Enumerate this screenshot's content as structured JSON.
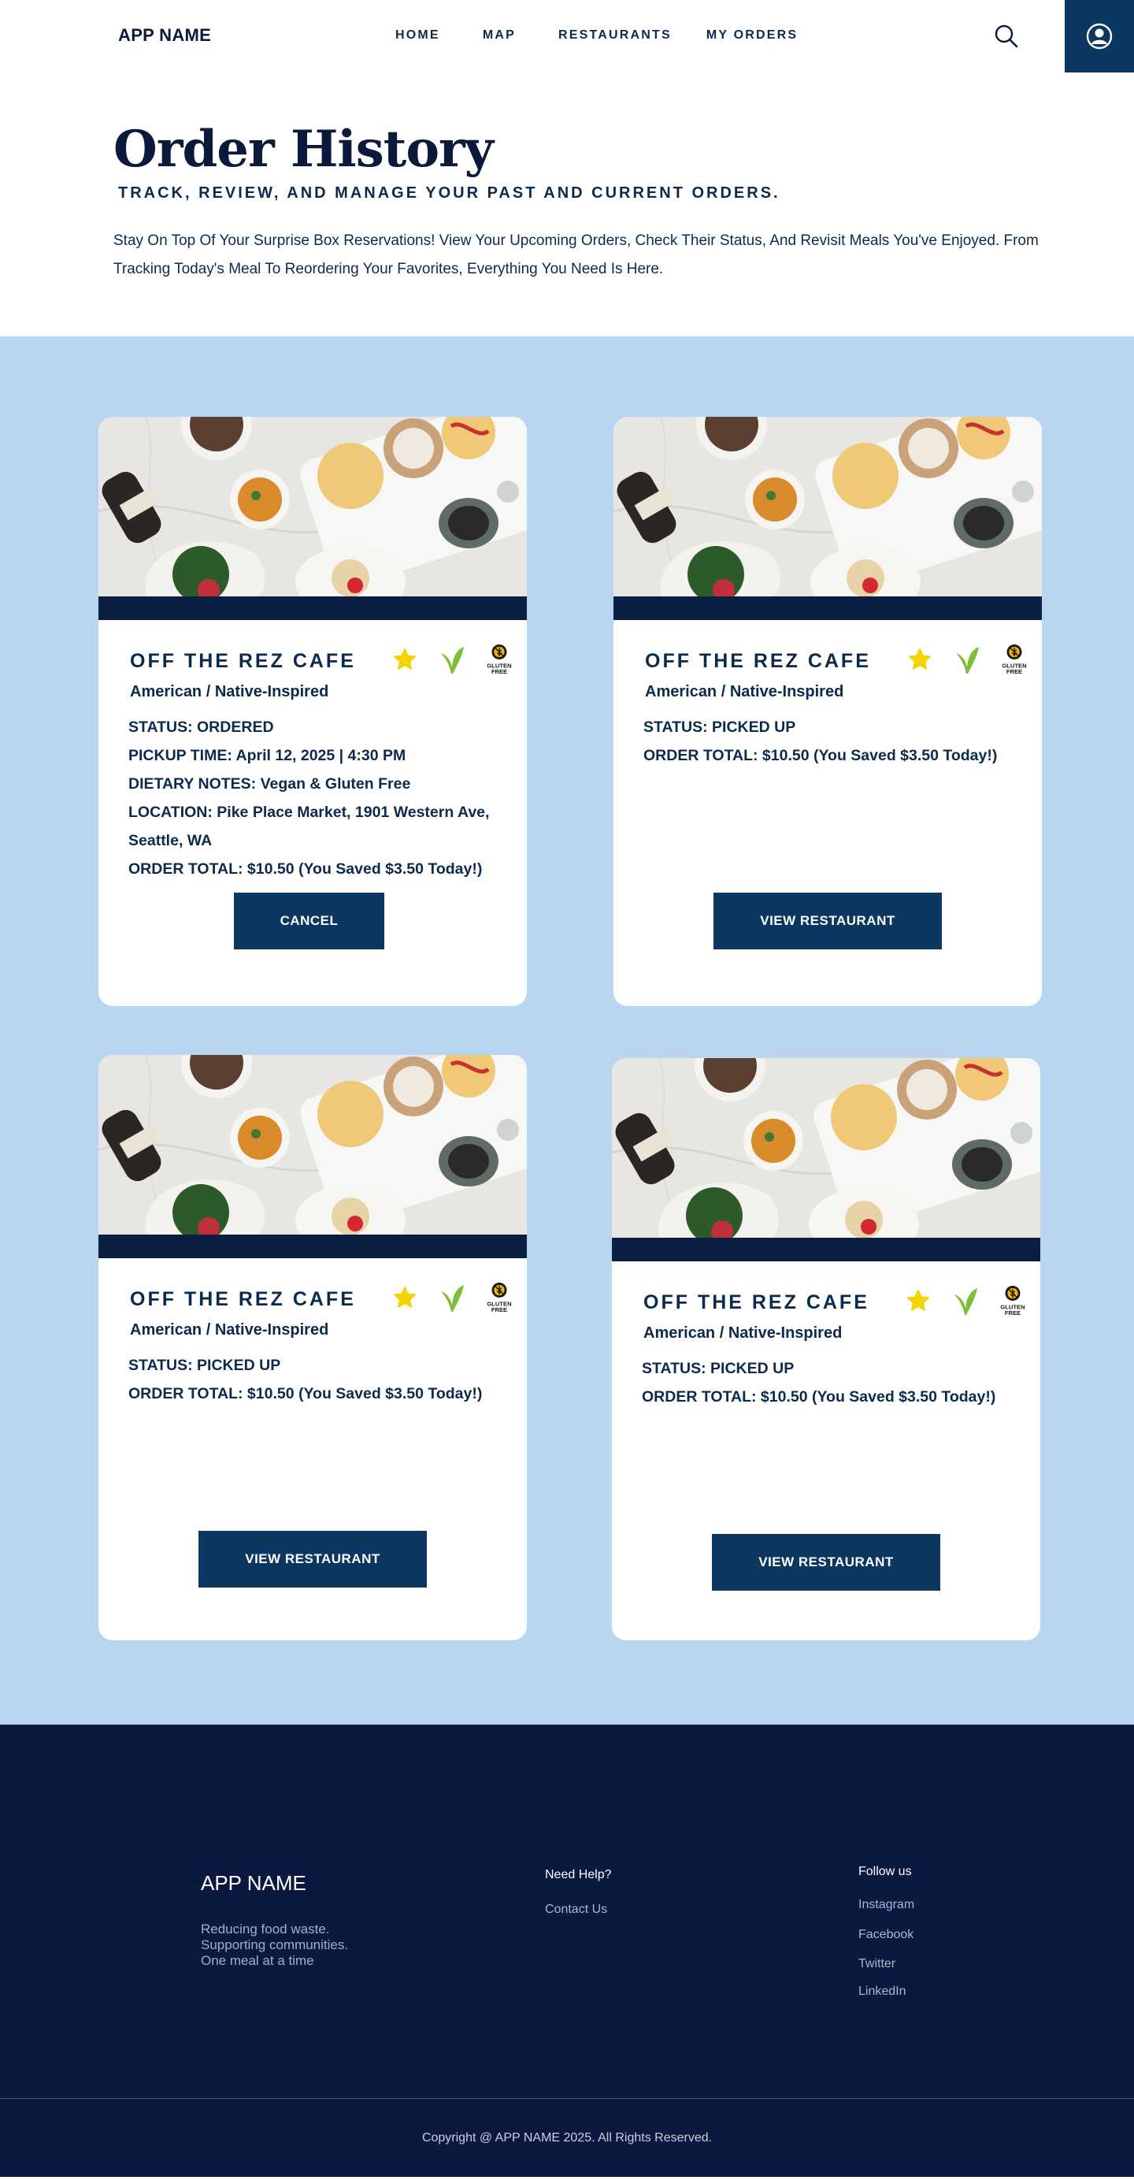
{
  "header": {
    "brand": "APP NAME",
    "nav": [
      "HOME",
      "MAP",
      "RESTAURANTS",
      "MY ORDERS"
    ],
    "icons": [
      "search-icon",
      "user-icon"
    ]
  },
  "intro": {
    "title": "Order History",
    "subtitle": "TRACK, REVIEW, AND MANAGE YOUR PAST AND CURRENT ORDERS.",
    "description": "Stay On Top Of Your Surprise Box Reservations! View Your Upcoming Orders, Check Their Status, And Revisit Meals You've Enjoyed. From Tracking Today's Meal To Reordering Your Favorites, Everything You Need Is Here."
  },
  "colors": {
    "accent": "#0b3760",
    "section_bg": "#b9d6f0",
    "footer_bg": "#0b1840",
    "band": "#0b1f45",
    "star": "#f5d300",
    "leaf": "#7cbf3a"
  },
  "orders": [
    {
      "name": "OFF THE REZ CAFE",
      "cuisine": "American / Native-Inspired",
      "badges": [
        "star-icon",
        "vegan-leaf-icon",
        "gluten-free-icon"
      ],
      "gluten_label": "GLUTEN FREE",
      "details": [
        "STATUS: ORDERED",
        "PICKUP TIME: April 12, 2025 | 4:30 PM",
        "DIETARY NOTES: Vegan & Gluten Free",
        "LOCATION: Pike Place Market, 1901 Western Ave,",
        "Seattle, WA",
        "ORDER TOTAL: $10.50 (You Saved $3.50 Today!)"
      ],
      "button": "CANCEL"
    },
    {
      "name": "OFF THE REZ CAFE",
      "cuisine": "American / Native-Inspired",
      "badges": [
        "star-icon",
        "vegan-leaf-icon",
        "gluten-free-icon"
      ],
      "gluten_label": "GLUTEN FREE",
      "details": [
        "STATUS: PICKED UP",
        "ORDER TOTAL: $10.50 (You Saved $3.50 Today!)"
      ],
      "button": "VIEW RESTAURANT"
    },
    {
      "name": "OFF THE REZ CAFE",
      "cuisine": "American / Native-Inspired",
      "badges": [
        "star-icon",
        "vegan-leaf-icon",
        "gluten-free-icon"
      ],
      "gluten_label": "GLUTEN FREE",
      "details": [
        "STATUS: PICKED UP",
        "ORDER TOTAL: $10.50 (You Saved $3.50 Today!)"
      ],
      "button": "VIEW RESTAURANT"
    },
    {
      "name": "OFF THE REZ CAFE",
      "cuisine": "American / Native-Inspired",
      "badges": [
        "star-icon",
        "vegan-leaf-icon",
        "gluten-free-icon"
      ],
      "gluten_label": "GLUTEN FREE",
      "details": [
        "STATUS: PICKED UP",
        "ORDER TOTAL: $10.50 (You Saved $3.50 Today!)"
      ],
      "button": "VIEW RESTAURANT"
    }
  ],
  "footer": {
    "brand": "APP NAME",
    "tagline": [
      "Reducing food waste.",
      "Supporting communities.",
      "One meal at a time"
    ],
    "help_title": "Need Help?",
    "contact": "Contact Us",
    "follow_title": "Follow us",
    "social": [
      "Instagram",
      "Facebook",
      "Twitter",
      "LinkedIn"
    ],
    "copyright": "Copyright @ APP NAME 2025. All Rights Reserved."
  }
}
